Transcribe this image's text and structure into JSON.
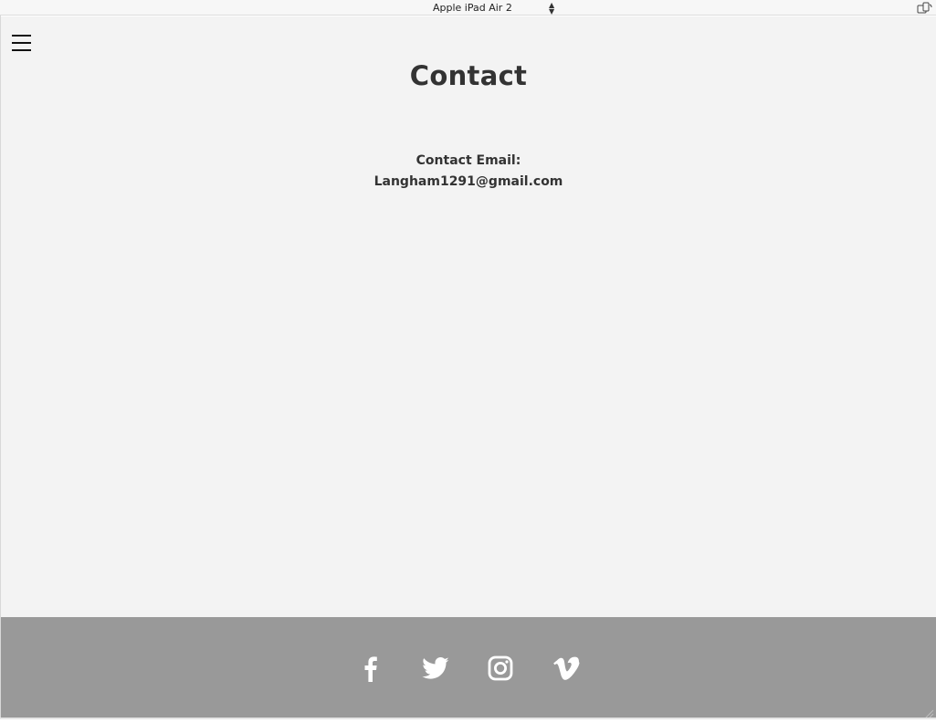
{
  "device_toolbar": {
    "device_name": "Apple iPad Air 2",
    "arrows_up": "▲",
    "arrows_down": "▼"
  },
  "header": {
    "menu_icon": "hamburger-menu-icon"
  },
  "main": {
    "title": "Contact",
    "contact_label": "Contact Email:",
    "contact_email": "Langham1291@gmail.com"
  },
  "footer": {
    "background": "#999999",
    "social_links": [
      {
        "icon": "facebook-icon"
      },
      {
        "icon": "twitter-icon"
      },
      {
        "icon": "instagram-icon"
      },
      {
        "icon": "vimeo-icon"
      }
    ]
  },
  "colors": {
    "page_background": "#f3f3f3",
    "text": "#333333",
    "icon": "#ffffff"
  }
}
